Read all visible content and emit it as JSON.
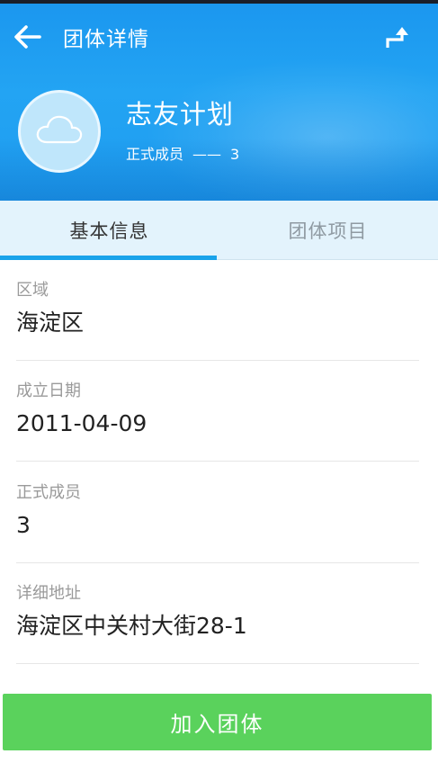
{
  "header": {
    "title": "团体详情",
    "back_icon": "arrow-left-icon",
    "share_icon": "share-arrow-icon",
    "background_color": "#1e9cf0"
  },
  "group": {
    "avatar_icon": "cloud-icon",
    "name": "志友计划",
    "member_label": "正式成员",
    "member_separator": "——",
    "member_count": "3"
  },
  "tabs": [
    {
      "label": "基本信息",
      "active": true
    },
    {
      "label": "团体项目",
      "active": false
    }
  ],
  "info": [
    {
      "label": "区域",
      "value": "海淀区"
    },
    {
      "label": "成立日期",
      "value": "2011-04-09"
    },
    {
      "label": "正式成员",
      "value": "3"
    },
    {
      "label": "详细地址",
      "value": "海淀区中关村大街28-1"
    }
  ],
  "actions": {
    "join_label": "加入团体",
    "join_color": "#5ad25c"
  },
  "colors": {
    "accent": "#1aa3ea",
    "tab_background": "#e3f3fc"
  }
}
